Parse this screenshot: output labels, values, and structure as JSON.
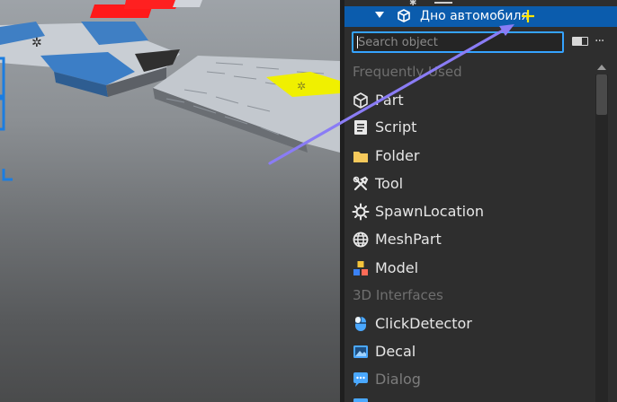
{
  "tree": {
    "selected_item_label": "Дно автомобиля",
    "expand_icon": "chevron-down-icon",
    "item_icon": "part-cube-icon"
  },
  "search": {
    "placeholder": "Search object",
    "value": ""
  },
  "toolbar": {
    "toggle_icon": "toggle-icon",
    "more_label": "···"
  },
  "sections": {
    "frequently_used": "Frequently Used",
    "interfaces_3d": "3D Interfaces"
  },
  "items": [
    {
      "label": "Part",
      "icon": "part-cube-icon"
    },
    {
      "label": "Script",
      "icon": "script-icon"
    },
    {
      "label": "Folder",
      "icon": "folder-icon"
    },
    {
      "label": "Tool",
      "icon": "tool-icon"
    },
    {
      "label": "SpawnLocation",
      "icon": "spawn-location-icon"
    },
    {
      "label": "MeshPart",
      "icon": "meshpart-icon"
    },
    {
      "label": "Model",
      "icon": "model-icon"
    },
    {
      "label": "ClickDetector",
      "icon": "click-detector-icon"
    },
    {
      "label": "Decal",
      "icon": "decal-icon"
    },
    {
      "label": "Dialog",
      "icon": "dialog-icon"
    }
  ],
  "colors": {
    "selection": "#0b5cad",
    "search_border": "#35a3ff",
    "panel_bg": "#2e2e2e",
    "drag_arrow": "#8a7cf5",
    "plus_cursor": "#ffe600"
  }
}
